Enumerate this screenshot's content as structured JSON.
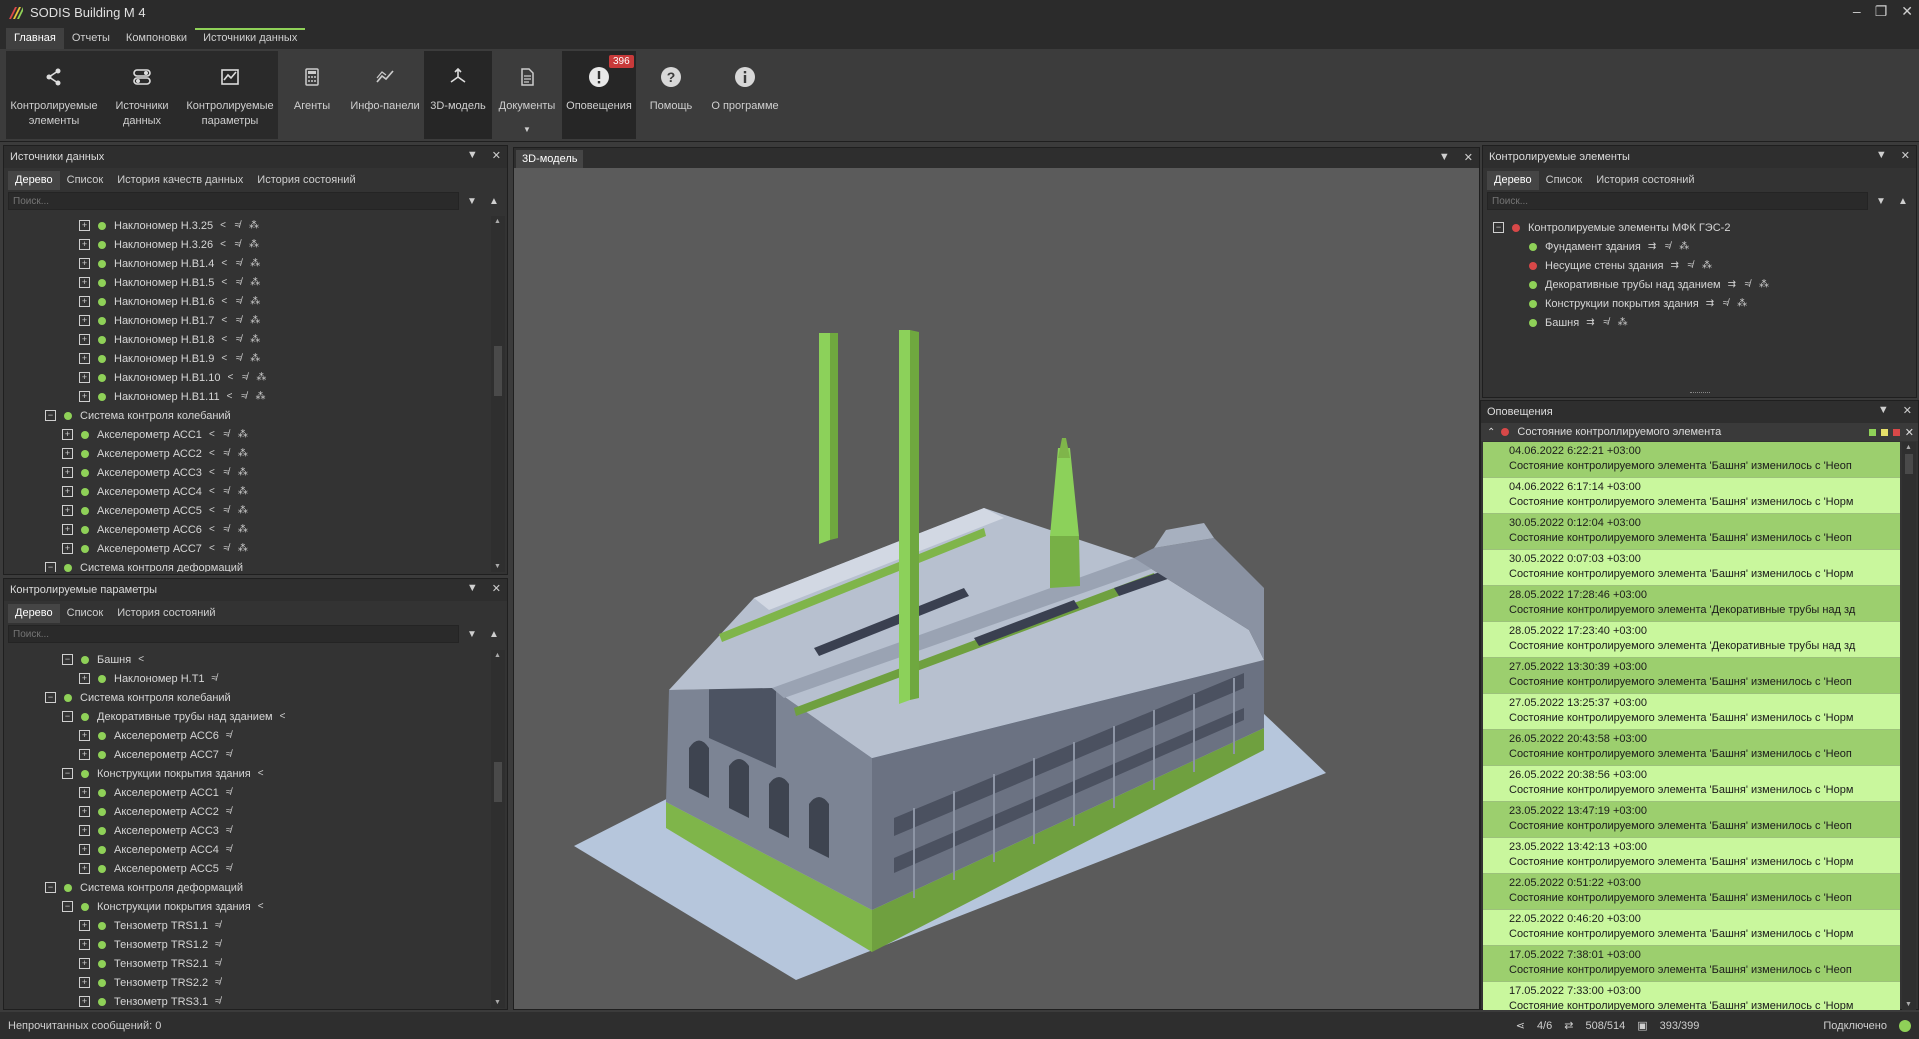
{
  "app": {
    "title": "SODIS Building M 4",
    "window_controls": [
      "‒",
      "❐",
      "✕"
    ]
  },
  "menu": {
    "tabs": [
      "Главная",
      "Отчеты",
      "Компоновки",
      "Источники данных"
    ]
  },
  "ribbon": {
    "buttons": [
      {
        "label": "Контролируемые элементы",
        "icon": "share-icon"
      },
      {
        "label": "Источники данных",
        "icon": "toggle-icon"
      },
      {
        "label": "Контролируемые параметры",
        "icon": "chart-icon"
      },
      {
        "label": "Агенты",
        "icon": "calculator-icon"
      },
      {
        "label": "Инфо-панели",
        "icon": "trend-icon"
      },
      {
        "label": "3D-модель",
        "icon": "model-icon"
      },
      {
        "label": "Документы",
        "icon": "document-icon"
      },
      {
        "label": "Оповещения",
        "icon": "alert-icon",
        "badge": "396"
      },
      {
        "label": "Помощь",
        "icon": "help-icon"
      },
      {
        "label": "О программе",
        "icon": "info-icon"
      }
    ]
  },
  "datasources": {
    "title": "Источники данных",
    "tabs": [
      "Дерево",
      "Список",
      "История качеств данных",
      "История состояний"
    ],
    "search_placeholder": "Поиск...",
    "rows": [
      {
        "label": "Наклономер Н.3.25",
        "level": 3,
        "exp": "+",
        "status": "green",
        "icons": "< ≉ ⁂"
      },
      {
        "label": "Наклономер Н.3.26",
        "level": 3,
        "exp": "+",
        "status": "green",
        "icons": "< ≉ ⁂"
      },
      {
        "label": "Наклономер Н.В1.4",
        "level": 3,
        "exp": "+",
        "status": "green",
        "icons": "< ≉ ⁂"
      },
      {
        "label": "Наклономер Н.В1.5",
        "level": 3,
        "exp": "+",
        "status": "green",
        "icons": "< ≉ ⁂"
      },
      {
        "label": "Наклономер Н.В1.6",
        "level": 3,
        "exp": "+",
        "status": "green",
        "icons": "< ≉ ⁂"
      },
      {
        "label": "Наклономер Н.В1.7",
        "level": 3,
        "exp": "+",
        "status": "green",
        "icons": "< ≉ ⁂"
      },
      {
        "label": "Наклономер Н.В1.8",
        "level": 3,
        "exp": "+",
        "status": "green",
        "icons": "< ≉ ⁂"
      },
      {
        "label": "Наклономер Н.В1.9",
        "level": 3,
        "exp": "+",
        "status": "green",
        "icons": "< ≉ ⁂"
      },
      {
        "label": "Наклономер Н.В1.10",
        "level": 3,
        "exp": "+",
        "status": "green",
        "icons": "< ≉ ⁂"
      },
      {
        "label": "Наклономер Н.В1.11",
        "level": 3,
        "exp": "+",
        "status": "green",
        "icons": "< ≉ ⁂"
      },
      {
        "label": "Система контроля колебаний",
        "level": 1,
        "exp": "−",
        "status": "green",
        "icons": ""
      },
      {
        "label": "Акселерометр АСС1",
        "level": 2,
        "exp": "+",
        "status": "green",
        "icons": "< ≉ ⁂"
      },
      {
        "label": "Акселерометр АСС2",
        "level": 2,
        "exp": "+",
        "status": "green",
        "icons": "< ≉ ⁂"
      },
      {
        "label": "Акселерометр АСС3",
        "level": 2,
        "exp": "+",
        "status": "green",
        "icons": "< ≉ ⁂"
      },
      {
        "label": "Акселерометр АСС4",
        "level": 2,
        "exp": "+",
        "status": "green",
        "icons": "< ≉ ⁂"
      },
      {
        "label": "Акселерометр АСС5",
        "level": 2,
        "exp": "+",
        "status": "green",
        "icons": "< ≉ ⁂"
      },
      {
        "label": "Акселерометр АСС6",
        "level": 2,
        "exp": "+",
        "status": "green",
        "icons": "< ≉ ⁂"
      },
      {
        "label": "Акселерометр АСС7",
        "level": 2,
        "exp": "+",
        "status": "green",
        "icons": "< ≉ ⁂"
      },
      {
        "label": "Система контроля деформаций",
        "level": 1,
        "exp": "−",
        "status": "green",
        "icons": ""
      }
    ]
  },
  "params": {
    "title": "Контролируемые параметры",
    "tabs": [
      "Дерево",
      "Список",
      "История состояний"
    ],
    "search_placeholder": "Поиск...",
    "rows": [
      {
        "label": "Башня",
        "level": 2,
        "exp": "−",
        "status": "green",
        "icons": "<"
      },
      {
        "label": "Наклономер Н.Т1",
        "level": 3,
        "exp": "+",
        "status": "green",
        "icons": "≉"
      },
      {
        "label": "Система контроля колебаний",
        "level": 1,
        "exp": "−",
        "status": "green",
        "icons": ""
      },
      {
        "label": "Декоративные трубы над зданием",
        "level": 2,
        "exp": "−",
        "status": "green",
        "icons": "<"
      },
      {
        "label": "Акселерометр АСС6",
        "level": 3,
        "exp": "+",
        "status": "green",
        "icons": "≉"
      },
      {
        "label": "Акселерометр АСС7",
        "level": 3,
        "exp": "+",
        "status": "green",
        "icons": "≉"
      },
      {
        "label": "Конструкции покрытия здания",
        "level": 2,
        "exp": "−",
        "status": "green",
        "icons": "<"
      },
      {
        "label": "Акселерометр АСС1",
        "level": 3,
        "exp": "+",
        "status": "green",
        "icons": "≉"
      },
      {
        "label": "Акселерометр АСС2",
        "level": 3,
        "exp": "+",
        "status": "green",
        "icons": "≉"
      },
      {
        "label": "Акселерометр АСС3",
        "level": 3,
        "exp": "+",
        "status": "green",
        "icons": "≉"
      },
      {
        "label": "Акселерометр АСС4",
        "level": 3,
        "exp": "+",
        "status": "green",
        "icons": "≉"
      },
      {
        "label": "Акселерометр АСС5",
        "level": 3,
        "exp": "+",
        "status": "green",
        "icons": "≉"
      },
      {
        "label": "Система контроля деформаций",
        "level": 1,
        "exp": "−",
        "status": "green",
        "icons": ""
      },
      {
        "label": "Конструкции покрытия здания",
        "level": 2,
        "exp": "−",
        "status": "green",
        "icons": "<"
      },
      {
        "label": "Тензометр TRS1.1",
        "level": 3,
        "exp": "+",
        "status": "green",
        "icons": "≉"
      },
      {
        "label": "Тензометр TRS1.2",
        "level": 3,
        "exp": "+",
        "status": "green",
        "icons": "≉"
      },
      {
        "label": "Тензометр TRS2.1",
        "level": 3,
        "exp": "+",
        "status": "green",
        "icons": "≉"
      },
      {
        "label": "Тензометр TRS2.2",
        "level": 3,
        "exp": "+",
        "status": "green",
        "icons": "≉"
      },
      {
        "label": "Тензометр TRS3.1",
        "level": 3,
        "exp": "+",
        "status": "green",
        "icons": "≉"
      }
    ]
  },
  "viewport": {
    "tab": "3D-модель"
  },
  "elements": {
    "title": "Контролируемые элементы",
    "tabs": [
      "Дерево",
      "Список",
      "История состояний"
    ],
    "search_placeholder": "Поиск...",
    "rows": [
      {
        "label": "Контролируемые элементы МФК ГЭС-2",
        "level": 0,
        "exp": "−",
        "status": "red",
        "icons": ""
      },
      {
        "label": "Фундамент здания",
        "level": 1,
        "exp": "",
        "status": "green",
        "icons": "⇉ ≉ ⁂"
      },
      {
        "label": "Несущие стены здания",
        "level": 1,
        "exp": "",
        "status": "red",
        "icons": "⇉ ≉ ⁂"
      },
      {
        "label": "Декоративные трубы над зданием",
        "level": 1,
        "exp": "",
        "status": "green",
        "icons": "⇉ ≉ ⁂"
      },
      {
        "label": "Конструкции покрытия здания",
        "level": 1,
        "exp": "",
        "status": "green",
        "icons": "⇉ ≉ ⁂"
      },
      {
        "label": "Башня",
        "level": 1,
        "exp": "",
        "status": "green",
        "icons": "⇉ ≉ ⁂"
      }
    ]
  },
  "alerts": {
    "title": "Оповещения",
    "group": "Состояние контроллируемого элемента",
    "items": [
      {
        "time": "04.06.2022 6:22:21 +03:00",
        "text": "Состояние контролируемого элемента 'Башня' изменилось с 'Неоп",
        "shade": "dark"
      },
      {
        "time": "04.06.2022 6:17:14 +03:00",
        "text": "Состояние контролируемого элемента 'Башня' изменилось с 'Норм",
        "shade": "light"
      },
      {
        "time": "30.05.2022 0:12:04 +03:00",
        "text": "Состояние контролируемого элемента 'Башня' изменилось с 'Неоп",
        "shade": "dark"
      },
      {
        "time": "30.05.2022 0:07:03 +03:00",
        "text": "Состояние контролируемого элемента 'Башня' изменилось с 'Норм",
        "shade": "light"
      },
      {
        "time": "28.05.2022 17:28:46 +03:00",
        "text": "Состояние контролируемого элемента 'Декоративные трубы над зд",
        "shade": "dark"
      },
      {
        "time": "28.05.2022 17:23:40 +03:00",
        "text": "Состояние контролируемого элемента 'Декоративные трубы над зд",
        "shade": "light"
      },
      {
        "time": "27.05.2022 13:30:39 +03:00",
        "text": "Состояние контролируемого элемента 'Башня' изменилось с 'Неоп",
        "shade": "dark"
      },
      {
        "time": "27.05.2022 13:25:37 +03:00",
        "text": "Состояние контролируемого элемента 'Башня' изменилось с 'Норм",
        "shade": "light"
      },
      {
        "time": "26.05.2022 20:43:58 +03:00",
        "text": "Состояние контролируемого элемента 'Башня' изменилось с 'Неоп",
        "shade": "dark"
      },
      {
        "time": "26.05.2022 20:38:56 +03:00",
        "text": "Состояние контролируемого элемента 'Башня' изменилось с 'Норм",
        "shade": "light"
      },
      {
        "time": "23.05.2022 13:47:19 +03:00",
        "text": "Состояние контролируемого элемента 'Башня' изменилось с 'Неоп",
        "shade": "dark"
      },
      {
        "time": "23.05.2022 13:42:13 +03:00",
        "text": "Состояние контролируемого элемента 'Башня' изменилось с 'Норм",
        "shade": "light"
      },
      {
        "time": "22.05.2022 0:51:22 +03:00",
        "text": "Состояние контролируемого элемента 'Башня' изменилось с 'Неоп",
        "shade": "dark"
      },
      {
        "time": "22.05.2022 0:46:20 +03:00",
        "text": "Состояние контролируемого элемента 'Башня' изменилось с 'Норм",
        "shade": "light"
      },
      {
        "time": "17.05.2022 7:38:01 +03:00",
        "text": "Состояние контролируемого элемента 'Башня' изменилось с 'Неоп",
        "shade": "dark"
      },
      {
        "time": "17.05.2022 7:33:00 +03:00",
        "text": "Состояние контролируемого элемента 'Башня' изменилось с 'Норм",
        "shade": "light"
      }
    ]
  },
  "status": {
    "unread": "Непрочитанных сообщений: 0",
    "elements_count": "4/6",
    "sources_count": "508/514",
    "params_count": "393/399",
    "connection": "Подключено"
  },
  "colors": {
    "green": "#8fd158",
    "red": "#d84848",
    "alert_dark": "#9ccf6e",
    "alert_light": "#c9f79d"
  }
}
